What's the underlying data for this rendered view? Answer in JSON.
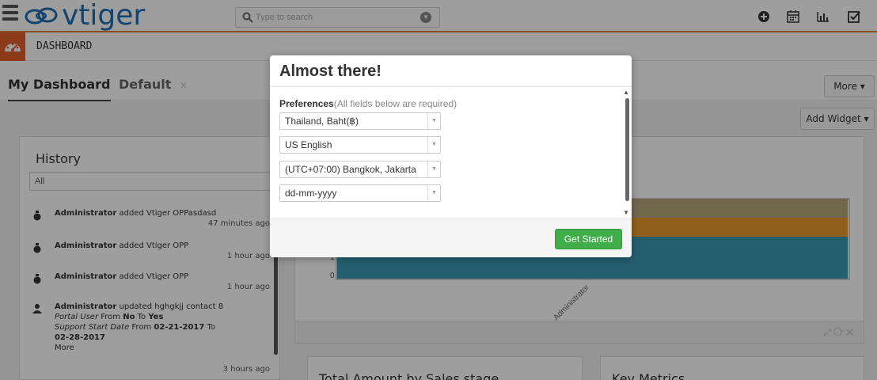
{
  "app": {
    "logo_text": "vtiger"
  },
  "header": {
    "search": {
      "placeholder": "Type to search"
    },
    "icons": [
      "add-icon",
      "calendar-icon",
      "reports-icon",
      "tasks-icon"
    ]
  },
  "module": {
    "title": "DASHBOARD"
  },
  "tabs": [
    {
      "label": "My Dashboard",
      "active": true
    },
    {
      "label": "Default",
      "close": "×"
    }
  ],
  "buttons": {
    "more": "More ▾",
    "add_widget": "Add Widget ▾"
  },
  "history": {
    "title": "History",
    "filter": "All",
    "items": [
      {
        "user": "Administrator",
        "action": " added Vtiger OPPasdasd",
        "time": "47 minutes ago"
      },
      {
        "user": "Administrator",
        "action": " added Vtiger OPP",
        "time": "1 hour ago"
      },
      {
        "user": "Administrator",
        "action": " added Vtiger OPP",
        "time": "1 hour ago"
      },
      {
        "user": "Administrator",
        "action": " updated hghgkjj contact 8",
        "field1_label": "Portal User",
        "field1_from": "No",
        "field1_to": "Yes",
        "field2_label": "Support Start Date",
        "field2_from": "02-21-2017",
        "field2_to": "02-28-2017",
        "more": "More",
        "time": "3 hours ago"
      }
    ]
  },
  "chart": {
    "x_tick": "Administrator",
    "y_ticks": [
      "0",
      "1"
    ],
    "colors": [
      "#b5a77d",
      "#e89a2d",
      "#3a9ab5"
    ]
  },
  "widgets": [
    {
      "title": "Total Amount by Sales stage"
    },
    {
      "title": "Key Metrics"
    }
  ],
  "modal": {
    "title": "Almost there!",
    "pref_label": "Preferences",
    "pref_note": "(All fields below are required)",
    "currency": "Thailand, Baht(฿)",
    "language": "US English",
    "timezone": "(UTC+07:00) Bangkok, Jakarta",
    "date_format": "dd-mm-yyyy",
    "submit": "Get Started"
  }
}
